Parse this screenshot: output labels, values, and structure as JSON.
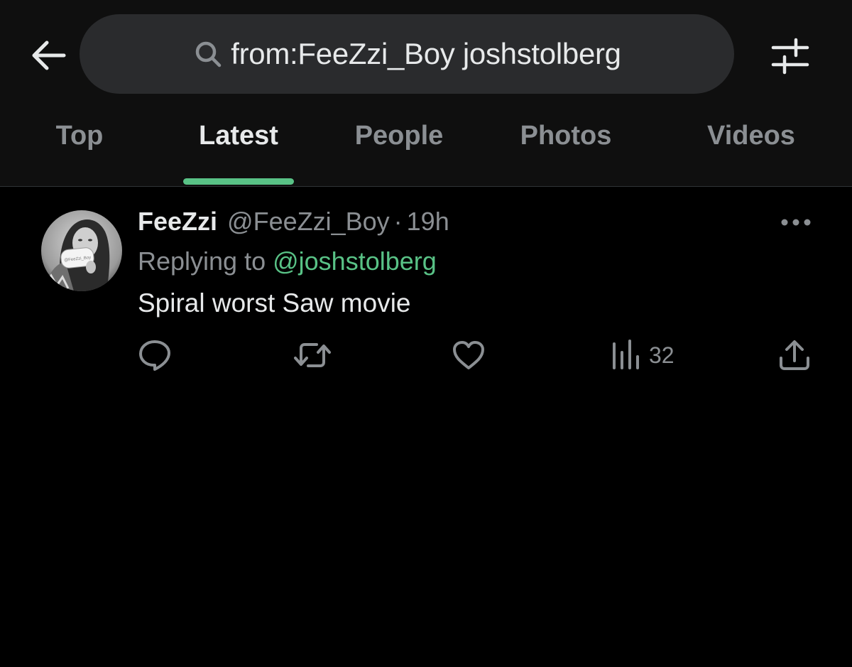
{
  "search": {
    "query": "from:FeeZzi_Boy joshstolberg"
  },
  "tabs": [
    {
      "label": "Top",
      "active": false
    },
    {
      "label": "Latest",
      "active": true
    },
    {
      "label": "People",
      "active": false
    },
    {
      "label": "Photos",
      "active": false
    },
    {
      "label": "Videos",
      "active": false
    }
  ],
  "tweet": {
    "display_name": "FeeZzi",
    "handle": "@FeeZzi_Boy",
    "separator": "·",
    "time": "19h",
    "replying_prefix": "Replying to",
    "replying_to": "@joshstolberg",
    "text": "Spiral worst Saw movie",
    "avatar_sign_text": "@FeeZzi_Boy",
    "actions": {
      "reply_icon": "speech-bubble",
      "retweet_icon": "retweet-arrows",
      "like_icon": "heart",
      "views_icon": "bar-chart",
      "views_count": "32",
      "share_icon": "upload-arrow"
    }
  },
  "colors": {
    "background": "#000000",
    "header_background": "#0f0f0f",
    "search_background": "#2a2b2d",
    "accent": "#59c286",
    "text_primary": "#e7e9ea",
    "text_secondary": "#8b8f93"
  }
}
